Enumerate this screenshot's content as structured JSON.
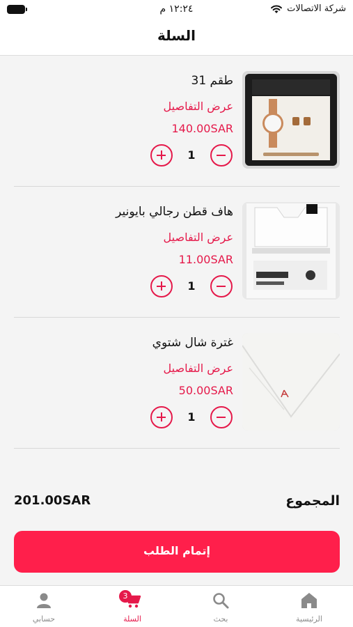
{
  "status_bar": {
    "carrier": "شركة الاتصالات",
    "time": "١٢:٢٤ م"
  },
  "header": {
    "title": "السلة"
  },
  "cart": {
    "items": [
      {
        "name": "طقم 31",
        "details_label": "عرض التفاصيل",
        "price": "140.00SAR",
        "quantity": "1",
        "image": "watch-gift-set"
      },
      {
        "name": "هاف قطن رجالي بايونير",
        "details_label": "عرض التفاصيل",
        "price": "11.00SAR",
        "quantity": "1",
        "image": "pioneer-undershirt-package"
      },
      {
        "name": "غترة شال شتوي",
        "details_label": "عرض التفاصيل",
        "price": "50.00SAR",
        "quantity": "1",
        "image": "white-shemagh"
      }
    ],
    "total_label": "المجموع",
    "total_value": "201.00SAR",
    "checkout_label": "إتمام الطلب"
  },
  "tab_bar": {
    "tabs": [
      {
        "label": "حسابي",
        "icon": "person-icon",
        "active": false
      },
      {
        "label": "السلة",
        "icon": "cart-icon",
        "active": true,
        "badge": "3"
      },
      {
        "label": "بحث",
        "icon": "search-icon",
        "active": false
      },
      {
        "label": "الرئيسية",
        "icon": "home-icon",
        "active": false
      }
    ]
  },
  "colors": {
    "accent": "#e5194a",
    "button": "#ff1f4b",
    "background": "#f4f4f4"
  }
}
